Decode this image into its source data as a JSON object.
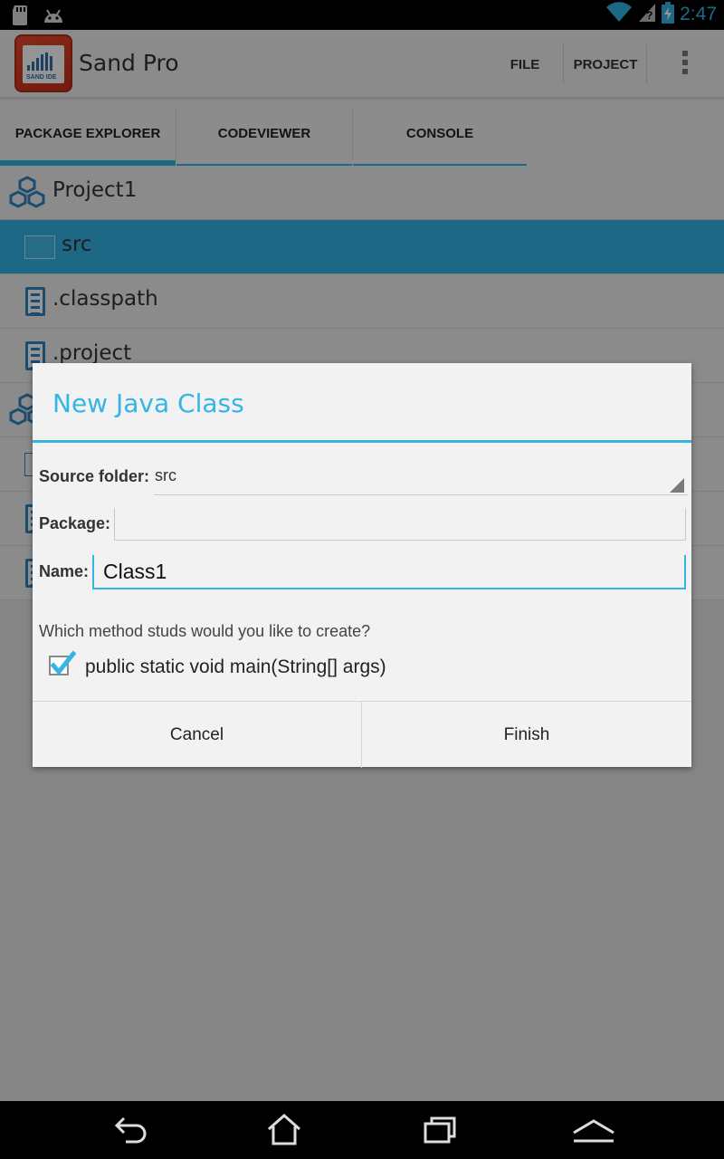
{
  "status_bar": {
    "time": "2:47",
    "icons": [
      "sd-card-icon",
      "android-debug-icon",
      "wifi-icon",
      "signal-icon",
      "battery-charging-icon"
    ]
  },
  "action_bar": {
    "app_title": "Sand Pro",
    "logo_text": "SAND IDE",
    "menu": {
      "file": "FILE",
      "project": "PROJECT"
    }
  },
  "tabs": [
    {
      "label": "PACKAGE EXPLORER",
      "active": true
    },
    {
      "label": "CODEVIEWER",
      "active": false
    },
    {
      "label": "CONSOLE",
      "active": false
    }
  ],
  "explorer": {
    "items": [
      {
        "label": "Project1",
        "type": "project"
      },
      {
        "label": "src",
        "type": "folder",
        "selected": true
      },
      {
        "label": ".classpath",
        "type": "file"
      },
      {
        "label": ".project",
        "type": "file"
      }
    ]
  },
  "dialog": {
    "title": "New Java Class",
    "source_folder_label": "Source folder:",
    "source_folder_value": "src",
    "package_label": "Package:",
    "package_value": "",
    "name_label": "Name:",
    "name_value": "Class1",
    "question": "Which method studs would you like to create?",
    "main_method_label": "public static void main(String[] args)",
    "main_method_checked": true,
    "cancel_label": "Cancel",
    "finish_label": "Finish"
  },
  "colors": {
    "accent": "#33b5e5",
    "status_bar": "#000000",
    "background": "#f0f0f0"
  }
}
